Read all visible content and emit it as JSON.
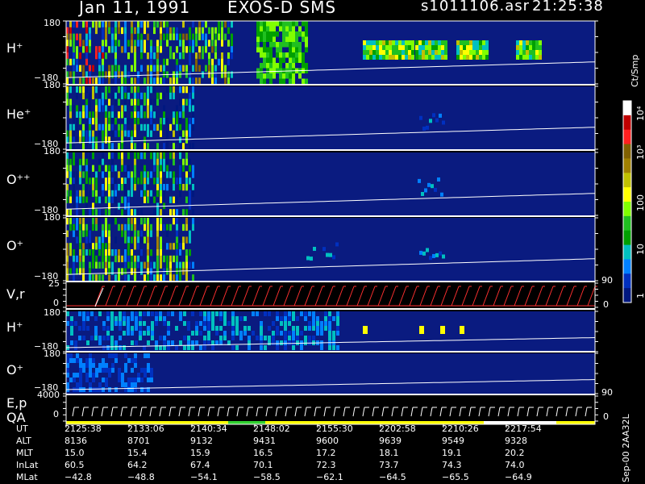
{
  "header": {
    "date": "Jan 11, 1991",
    "mission": "EXOS-D SMS",
    "file": "s1011106.asr",
    "time": "21:25:38"
  },
  "colorbar": {
    "unit": "Ct/Smp",
    "labels": [
      "10⁴",
      "10³",
      "100",
      "10",
      "1"
    ],
    "colors": [
      "#ffffff",
      "#c00000",
      "#ff2020",
      "#806000",
      "#a08000",
      "#c0c000",
      "#ffff00",
      "#80ff00",
      "#20c020",
      "#00a000",
      "#00c0c0",
      "#0080ff",
      "#0030c0",
      "#001880"
    ]
  },
  "panels": [
    {
      "label": "H⁺",
      "ymax": "180",
      "ymin": "−180"
    },
    {
      "label": "He⁺",
      "ymax": "180",
      "ymin": "−180"
    },
    {
      "label": "O⁺⁺",
      "ymax": "180",
      "ymin": "−180"
    },
    {
      "label": "O⁺",
      "ymax": "180",
      "ymin": "−180"
    },
    {
      "label": "V,r",
      "ymax": "25",
      "ymin": "0"
    },
    {
      "label": "H⁺",
      "ymax": "180",
      "ymin": "−180"
    },
    {
      "label": "O⁺",
      "ymax": "180",
      "ymin": "−180"
    },
    {
      "label": "E,p",
      "ymax": "4000",
      "ymin": ""
    }
  ],
  "extra_labels": {
    "qa": "QA",
    "qa_zero": "0",
    "right_90_a": "90",
    "right_0_a": "0",
    "right_90_b": "90",
    "right_0_b": "0",
    "footer_note": "Sep-00 2AA32L"
  },
  "table": {
    "rows": [
      {
        "name": "UT",
        "values": [
          "2125:38",
          "2133:06",
          "2140:34",
          "2148:02",
          "2155:30",
          "2202:58",
          "2210:26",
          "2217:54"
        ]
      },
      {
        "name": "ALT",
        "values": [
          "8136",
          "8701",
          "9132",
          "9431",
          "9600",
          "9639",
          "9549",
          "9328"
        ]
      },
      {
        "name": "MLT",
        "values": [
          "15.0",
          "15.4",
          "15.9",
          "16.5",
          "17.2",
          "18.1",
          "19.1",
          "20.2"
        ]
      },
      {
        "name": "InLat",
        "values": [
          "60.5",
          "64.2",
          "67.4",
          "70.1",
          "72.3",
          "73.7",
          "74.3",
          "74.0"
        ]
      },
      {
        "name": "MLat",
        "values": [
          "−42.8",
          "−48.8",
          "−54.1",
          "−58.5",
          "−62.1",
          "−64.5",
          "−65.5",
          "−64.9"
        ]
      }
    ]
  },
  "chart_data": {
    "type": "heatmap",
    "x_ticks_ut": [
      "2125:38",
      "2133:06",
      "2140:34",
      "2148:02",
      "2155:30",
      "2202:58",
      "2210:26",
      "2217:54"
    ],
    "x_range_ut": [
      "2125:38",
      "2222:00"
    ],
    "color_scale": "log",
    "color_range": [
      1,
      10000
    ],
    "grid": false,
    "series": [
      {
        "name": "H⁺",
        "y_range": [
          -180,
          180
        ]
      },
      {
        "name": "He⁺",
        "y_range": [
          -180,
          180
        ]
      },
      {
        "name": "O⁺⁺",
        "y_range": [
          -180,
          180
        ]
      },
      {
        "name": "O⁺",
        "y_range": [
          -180,
          180
        ]
      },
      {
        "name": "V,r",
        "y_range": [
          0,
          25
        ]
      },
      {
        "name": "H⁺",
        "y_range": [
          -180,
          180
        ]
      },
      {
        "name": "O⁺",
        "y_range": [
          -180,
          180
        ]
      },
      {
        "name": "E,p",
        "y_range": [
          0,
          4000
        ]
      }
    ]
  }
}
